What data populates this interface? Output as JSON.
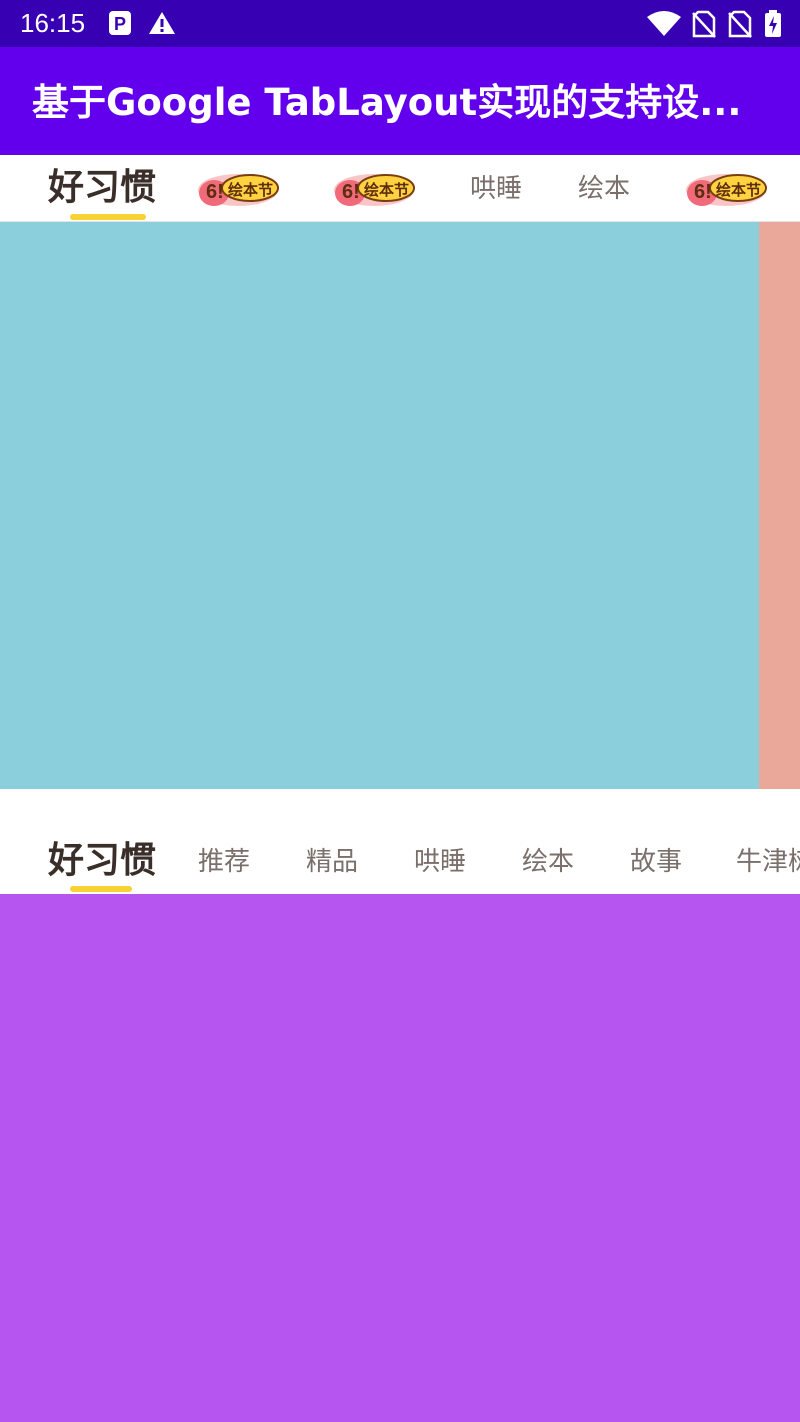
{
  "status_bar": {
    "time": "16:15",
    "icons": [
      "parking-icon",
      "warning-icon",
      "wifi-icon",
      "no-sim-icon",
      "no-sim-icon",
      "battery-charging-icon"
    ]
  },
  "app_bar": {
    "title": "基于Google TabLayout实现的支持设..."
  },
  "tablayout_1": {
    "tabs": [
      {
        "label": "好习惯",
        "type": "text",
        "selected": true
      },
      {
        "label": "6!绘本节",
        "type": "image"
      },
      {
        "label": "6!绘本节",
        "type": "image"
      },
      {
        "label": "哄睡",
        "type": "text"
      },
      {
        "label": "绘本",
        "type": "text"
      },
      {
        "label": "6!绘本节",
        "type": "image"
      }
    ],
    "indicator_color": "#f7d232"
  },
  "viewpager_1": {
    "current_page_color": "#8ccfdc",
    "next_page_color": "#e9a89a"
  },
  "tablayout_2": {
    "tabs": [
      {
        "label": "好习惯",
        "selected": true
      },
      {
        "label": "推荐"
      },
      {
        "label": "精品"
      },
      {
        "label": "哄睡"
      },
      {
        "label": "绘本"
      },
      {
        "label": "故事"
      },
      {
        "label": "牛津树"
      }
    ],
    "indicator_color": "#f7d232"
  },
  "viewpager_2": {
    "current_page_color": "#b655f0"
  },
  "colors": {
    "status_bar": "#3700b3",
    "app_bar": "#6200ee",
    "tab_text": "#7a6f6a",
    "tab_selected_text": "#3a2e2a"
  }
}
